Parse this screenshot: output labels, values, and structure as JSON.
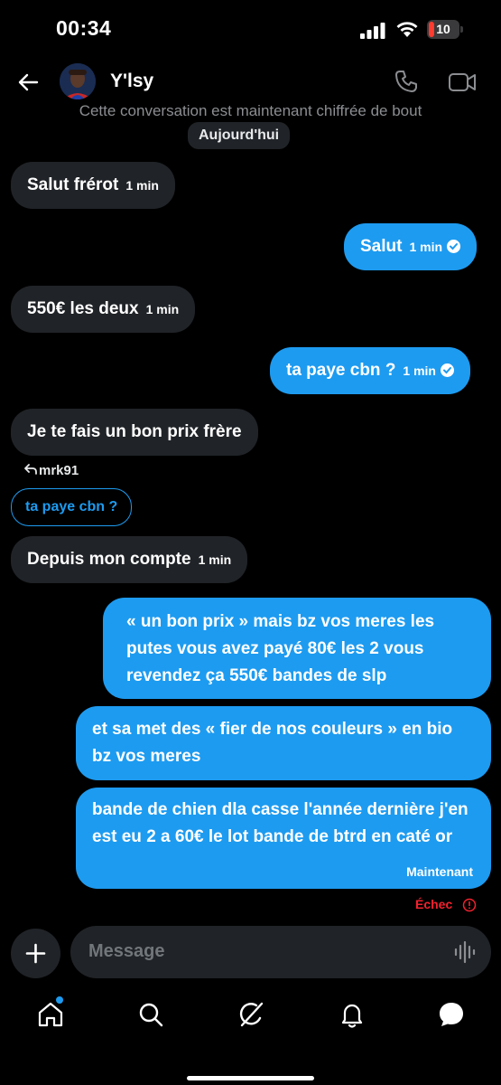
{
  "status_bar": {
    "time": "00:34",
    "battery": "10"
  },
  "header": {
    "contact_name": "Y'lsy"
  },
  "encryption_note": "Cette conversation est maintenant chiffrée de bout",
  "date_chip": "Aujourd'hui",
  "messages": [
    {
      "text": "Salut frérot",
      "meta": "1 min",
      "side": "received"
    },
    {
      "text": "Salut",
      "meta": "1 min",
      "side": "sent"
    },
    {
      "text": "550€ les deux",
      "meta": "1 min",
      "side": "received"
    },
    {
      "text": "ta paye cbn ?",
      "meta": "1 min",
      "side": "sent"
    },
    {
      "text": "Je te fais un bon prix frère",
      "meta": "",
      "side": "received"
    },
    {
      "text": "Depuis mon compte",
      "meta": "1 min",
      "side": "received"
    },
    {
      "text": "« un bon prix » mais bz vos meres les putes vous avez payé 80€ les 2 vous revendez ça 550€ bandes de slp",
      "meta": "",
      "side": "sent"
    },
    {
      "text": "et sa met des « fier de nos couleurs » en bio bz vos meres",
      "meta": "",
      "side": "sent"
    },
    {
      "text": "bande de chien dla casse l'année dernière j'en est eu 2 a 60€ le lot bande de btrd en caté or",
      "meta": "Maintenant",
      "side": "sent"
    }
  ],
  "reply": {
    "label": "mrk91",
    "quoted_text": "ta paye cbn ?"
  },
  "failed_label": "Échec",
  "composer": {
    "placeholder": "Message"
  },
  "colors": {
    "accent": "#1d9bf0",
    "bubble_received": "#202327",
    "error": "#f4212e"
  },
  "icons": [
    "back-arrow-icon",
    "phone-icon",
    "video-icon",
    "plus-icon",
    "audio-wave-icon",
    "home-icon",
    "search-icon",
    "grok-icon",
    "bell-icon",
    "messages-icon"
  ]
}
